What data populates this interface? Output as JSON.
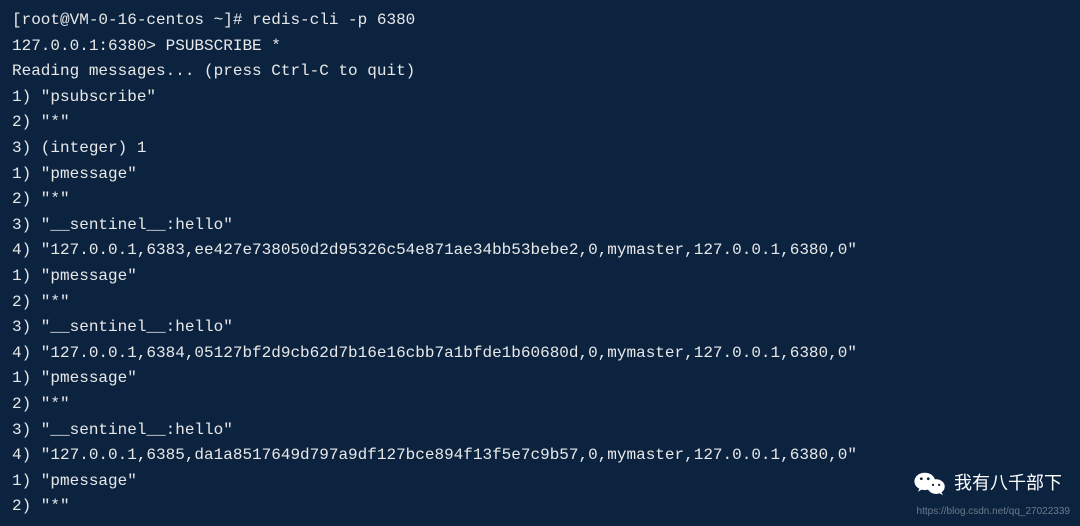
{
  "terminal": {
    "line1": "[root@VM-0-16-centos ~]# redis-cli -p 6380",
    "line2": "127.0.0.1:6380> PSUBSCRIBE *",
    "line3": "Reading messages... (press Ctrl-C to quit)",
    "line4": "1) \"psubscribe\"",
    "line5": "2) \"*\"",
    "line6": "3) (integer) 1",
    "line7": "1) \"pmessage\"",
    "line8": "2) \"*\"",
    "line9": "3) \"__sentinel__:hello\"",
    "line10": "4) \"127.0.0.1,6383,ee427e738050d2d95326c54e871ae34bb53bebe2,0,mymaster,127.0.0.1,6380,0\"",
    "line11": "1) \"pmessage\"",
    "line12": "2) \"*\"",
    "line13": "3) \"__sentinel__:hello\"",
    "line14": "4) \"127.0.0.1,6384,05127bf2d9cb62d7b16e16cbb7a1bfde1b60680d,0,mymaster,127.0.0.1,6380,0\"",
    "line15": "1) \"pmessage\"",
    "line16": "2) \"*\"",
    "line17": "3) \"__sentinel__:hello\"",
    "line18": "4) \"127.0.0.1,6385,da1a8517649d797a9df127bce894f13f5e7c9b57,0,mymaster,127.0.0.1,6380,0\"",
    "line19": "1) \"pmessage\"",
    "line20": "2) \"*\""
  },
  "watermark": {
    "text": "我有八千部下",
    "blog_url": "https://blog.csdn.net/qq_27022339"
  }
}
